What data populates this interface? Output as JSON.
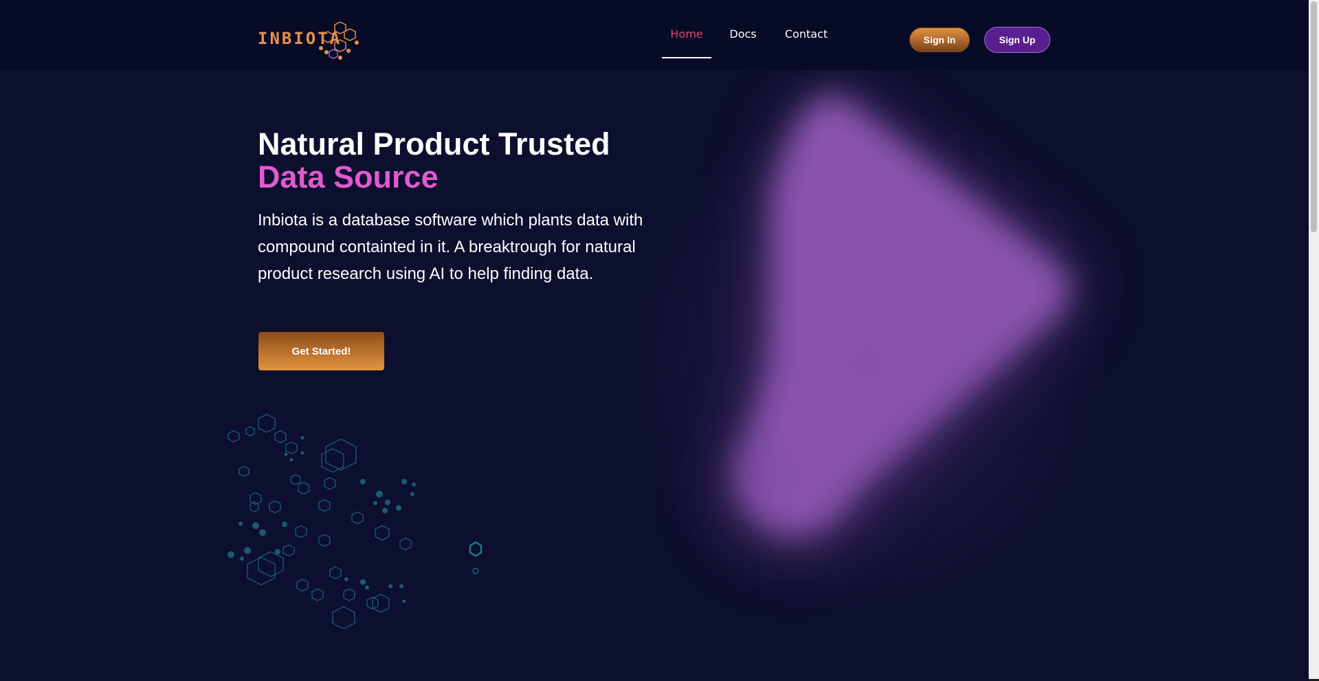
{
  "brand": {
    "logo_text": "INBIOTA",
    "primary_color": "#e8904a",
    "accent_color": "#e05ad0"
  },
  "nav": {
    "links": [
      {
        "label": "Home",
        "active": true
      },
      {
        "label": "Docs",
        "active": false
      },
      {
        "label": "Contact",
        "active": false
      }
    ],
    "sign_in_label": "Sign In",
    "sign_up_label": "Sign Up"
  },
  "hero": {
    "title_line1": "Natural Product Trusted",
    "title_line2": "Data Source",
    "description": "Inbiota is a database software which plants data with compound containted in it. A breaktrough for natural product research using AI to help finding data.",
    "cta_label": "Get Started!"
  },
  "icons": {
    "logo_decoration": "hexagon-cluster-icon",
    "hero_decoration": "hexagon-molecule-icon",
    "hero_shape": "chevron-blob"
  }
}
